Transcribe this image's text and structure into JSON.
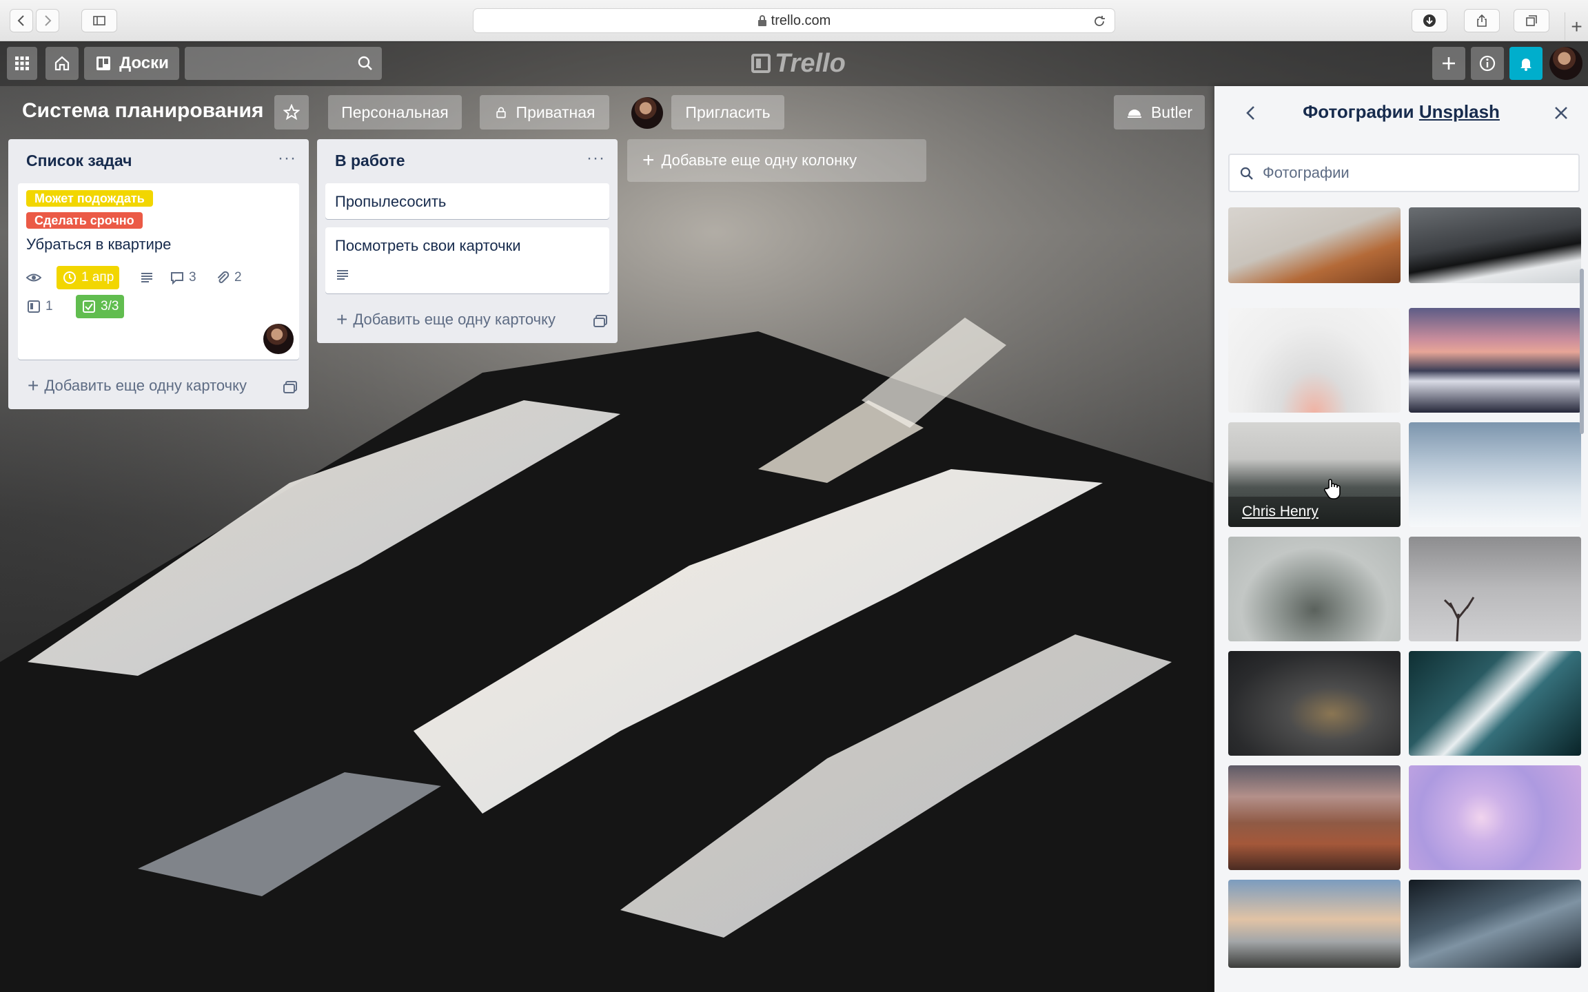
{
  "browser": {
    "url": "trello.com"
  },
  "header": {
    "boards_label": "Доски",
    "logo_text": "Trello"
  },
  "board": {
    "title": "Система планирования",
    "visibility_team": "Персональная",
    "visibility_private": "Приватная",
    "invite_label": "Пригласить",
    "butler_label": "Butler",
    "add_list_label": "Добавьте еще одну колонку"
  },
  "lists": [
    {
      "title": "Список задач",
      "add_card_label": "Добавить еще одну карточку",
      "card": {
        "labels": [
          "Может подождать",
          "Сделать срочно"
        ],
        "label_colors": [
          "#f2d600",
          "#eb5a46"
        ],
        "title": "Убраться в квартире",
        "due": "1 апр",
        "comments": "3",
        "attachments": "2",
        "boards": "1",
        "checklist": "3/3"
      }
    },
    {
      "title": "В работе",
      "add_card_label": "Добавить еще одну карточку",
      "cards": [
        {
          "title": "Пропылесосить"
        },
        {
          "title": "Посмотреть свои карточки"
        }
      ]
    }
  ],
  "panel": {
    "title_prefix": "Фотографии",
    "title_link": "Unsplash",
    "search_placeholder": "Фотографии",
    "hover_credit": "Chris Henry",
    "photos": [
      "warm-hill",
      "dark-ridge",
      "fog-sunset",
      "pink-mountains",
      "forest-fog",
      "blue-clouds",
      "misty-hill",
      "bare-tree",
      "dark-blur",
      "ocean-waves",
      "canyon-storm",
      "purple-sky",
      "sky-valley",
      "dark-wave"
    ]
  },
  "colors": {
    "accent_bell": "#00aecc",
    "due_badge": "#f2d600",
    "checklist_badge": "#61bd4f"
  }
}
